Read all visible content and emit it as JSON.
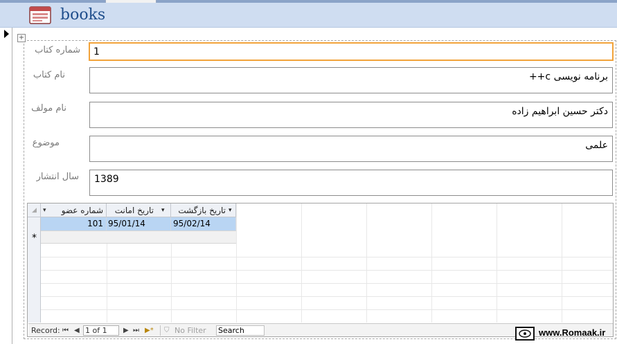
{
  "form": {
    "title": "books"
  },
  "fields": [
    {
      "label": "شماره کتاب",
      "value": "1"
    },
    {
      "label": "نام کتاب",
      "value": "برنامه نویسی c++"
    },
    {
      "label": "نام مولف",
      "value": "دکتر حسین ابراهیم زاده"
    },
    {
      "label": "موضوع",
      "value": "علمی"
    },
    {
      "label": "سال انتشار",
      "value": "1389"
    }
  ],
  "subform": {
    "columns": [
      "شماره عضو",
      "تاریخ امانت",
      "تاریخ بازگشت"
    ],
    "rows": [
      [
        "101",
        "95/01/14",
        "95/02/14"
      ]
    ],
    "new_row_marker": "*"
  },
  "navigation": {
    "record_label": "Record:",
    "first": "⏮",
    "prev": "◀",
    "position": "1 of 1",
    "next": "▶",
    "last": "⏭",
    "new": "▶*",
    "filter": "No Filter",
    "search": "Search"
  },
  "watermark": {
    "text": "www.Romaak.ir"
  },
  "colors": {
    "header_bg": "#cfddf1",
    "focus_border": "#f2a33a",
    "row_highlight": "#b9d5f3",
    "title": "#1f4e8c"
  }
}
